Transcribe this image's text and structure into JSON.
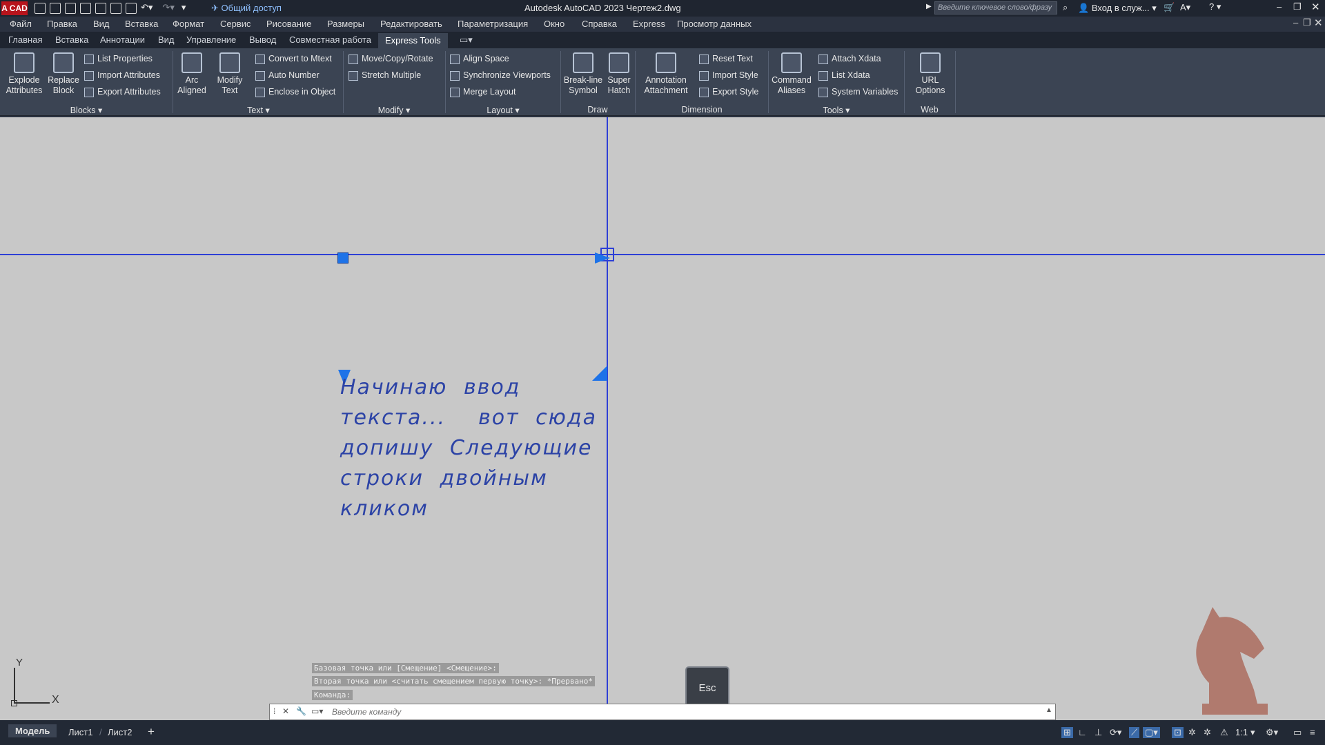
{
  "titlebar": {
    "app_icon": "A CAD",
    "share_label": "Общий доступ",
    "title": "Autodesk AutoCAD 2023    Чертеж2.dwg",
    "search_placeholder": "Введите ключевое слово/фразу",
    "login": "Вход в служ..."
  },
  "menu": [
    "Файл",
    "Правка",
    "Вид",
    "Вставка",
    "Формат",
    "Сервис",
    "Рисование",
    "Размеры",
    "Редактировать",
    "Параметризация",
    "Окно",
    "Справка",
    "Express",
    "Просмотр данных"
  ],
  "tabs": [
    "Главная",
    "Вставка",
    "Аннотации",
    "Вид",
    "Управление",
    "Вывод",
    "Совместная работа",
    "Express Tools"
  ],
  "ribbon": {
    "explode_attributes": "Explode\nAttributes",
    "replace_block": "Replace\nBlock",
    "list_properties": "List Properties",
    "import_attributes": "Import Attributes",
    "export_attributes": "Export Attributes",
    "blocks_panel": "Blocks ▾",
    "arc_aligned": "Arc\nAligned",
    "modify_text": "Modify\nText",
    "convert_to_mtext": "Convert to Mtext",
    "auto_number": "Auto Number",
    "enclose_in_object": "Enclose in Object",
    "text_panel": "Text ▾",
    "move_copy_rotate": "Move/Copy/Rotate",
    "stretch_multiple": "Stretch Multiple",
    "modify_panel": "Modify ▾",
    "align_space": "Align Space",
    "synchronize_viewports": "Synchronize Viewports",
    "merge_layout": "Merge Layout",
    "layout_panel": "Layout ▾",
    "break_line_symbol": "Break-line\nSymbol",
    "super_hatch": "Super\nHatch",
    "draw_panel": "Draw",
    "annotation_attachment": "Annotation\nAttachment",
    "reset_text": "Reset Text",
    "import_style": "Import Style",
    "export_style": "Export Style",
    "dimension_panel": "Dimension",
    "command_aliases": "Command\nAliases",
    "attach_xdata": "Attach Xdata",
    "list_xdata": "List Xdata",
    "system_variables": "System Variables",
    "tools_panel": "Tools ▾",
    "url_options": "URL\nOptions",
    "web_panel": "Web"
  },
  "drawing": {
    "mtext_lines": [
      "Начинаю ввод",
      "текста...  вот сюда",
      "допишу Следующие",
      "строки двойным кликом"
    ],
    "ucs_y": "Y",
    "ucs_x": "X"
  },
  "command": {
    "history": [
      "Базовая точка или [Смещение] <Смещение>:",
      "Вторая точка или <считать смещением первую точку>: *Прервано*",
      "Команда:"
    ],
    "placeholder": "Введите команду",
    "esc_key": "Esc"
  },
  "status": {
    "tabs": [
      "Модель",
      "Лист1",
      "Лист2"
    ],
    "scale": "1:1"
  },
  "colors": {
    "canvas": "#c8c8c8",
    "ribbon": "#3b4453",
    "crosshair": "#2d3fd6",
    "mtext": "#2c43a6",
    "grip": "#1e73e8",
    "logo": "#b07a6e"
  }
}
